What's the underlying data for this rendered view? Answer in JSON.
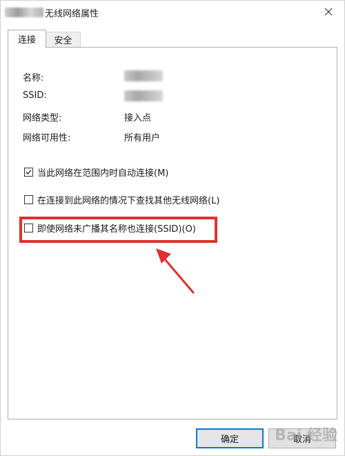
{
  "window": {
    "title": "无线网络属性",
    "close_icon": "close-icon"
  },
  "tabs": [
    {
      "label": "连接",
      "active": true
    },
    {
      "label": "安全",
      "active": false
    }
  ],
  "info": {
    "name_label": "名称:",
    "ssid_label": "SSID:",
    "type_label": "网络类型:",
    "type_value": "接入点",
    "availability_label": "网络可用性:",
    "availability_value": "所有用户"
  },
  "options": [
    {
      "label": "当此网络在范围内时自动连接(M)",
      "checked": true
    },
    {
      "label": "在连接到此网络的情况下查找其他无线网络(L)",
      "checked": false
    },
    {
      "label": "即使网络未广播其名称也连接(SSID)(O)",
      "checked": false
    }
  ],
  "annotation": {
    "highlight_color": "#e0302e"
  },
  "buttons": {
    "ok_label": "确定",
    "cancel_label": "取消"
  },
  "watermark": {
    "text": "Bai 经验"
  }
}
